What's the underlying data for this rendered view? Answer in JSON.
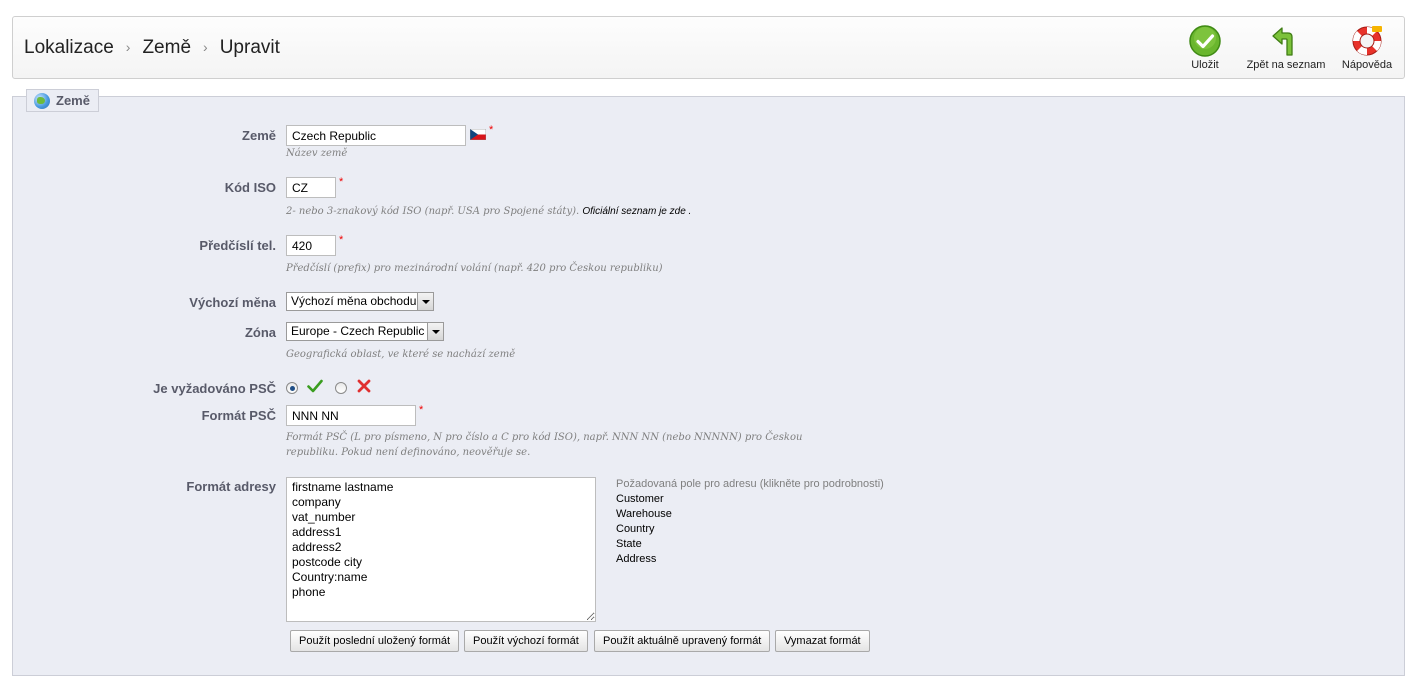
{
  "breadcrumb": {
    "items": [
      "Lokalizace",
      "Země",
      "Upravit"
    ],
    "separator": "›"
  },
  "toolbar": {
    "save_label": "Uložit",
    "back_label": "Zpět na seznam",
    "help_label": "Nápověda"
  },
  "panel": {
    "legend": "Země"
  },
  "form": {
    "country": {
      "label": "Země",
      "value": "Czech Republic",
      "hint": "Název země",
      "required": "*"
    },
    "iso": {
      "label": "Kód ISO",
      "value": "CZ",
      "required": "*",
      "hint": "2- nebo 3-znakový kód ISO (např. USA pro Spojené státy).",
      "hint_link": "Oficiální seznam je zde ."
    },
    "prefix": {
      "label": "Předčíslí tel.",
      "value": "420",
      "required": "*",
      "hint": "Předčíslí (prefix) pro mezinárodní volání (např. 420 pro Českou republiku)"
    },
    "currency": {
      "label": "Výchozí měna",
      "selected": "Výchozí měna obchodu"
    },
    "zone": {
      "label": "Zóna",
      "selected": "Europe - Czech Republic",
      "hint": "Geografická oblast, ve které se nachází země"
    },
    "zip_required": {
      "label": "Je vyžadováno PSČ",
      "selected": "yes"
    },
    "zip_format": {
      "label": "Formát PSČ",
      "value": "NNN NN",
      "required": "*",
      "hint_line1": "Formát PSČ (L pro písmeno, N pro číslo a C pro kód ISO), např. NNN NN (nebo NNNNN) pro Českou",
      "hint_line2": "republiku. Pokud není definováno, neověřuje se."
    },
    "address_format": {
      "label": "Formát adresy",
      "value": "firstname lastname\ncompany\nvat_number\naddress1\naddress2\npostcode city\nCountry:name\nphone",
      "help_title": "Požadovaná pole pro adresu (klikněte pro podrobnosti)",
      "help_items": [
        "Customer",
        "Warehouse",
        "Country",
        "State",
        "Address"
      ]
    },
    "buttons": {
      "last_saved": "Použít poslední uložený formát",
      "default": "Použít výchozí formát",
      "current": "Použít aktuálně upravený formát",
      "clear": "Vymazat formát"
    }
  },
  "colors": {
    "accent": "#585a69",
    "panel_bg": "#ebedf4",
    "required": "#e00000",
    "yes": "#3a9d1f",
    "no": "#e03030"
  },
  "icons": {
    "save": "check-circle-icon",
    "back": "arrow-back-icon",
    "help": "lifebuoy-icon",
    "flag": "czech-flag-icon",
    "globe": "globe-icon"
  }
}
